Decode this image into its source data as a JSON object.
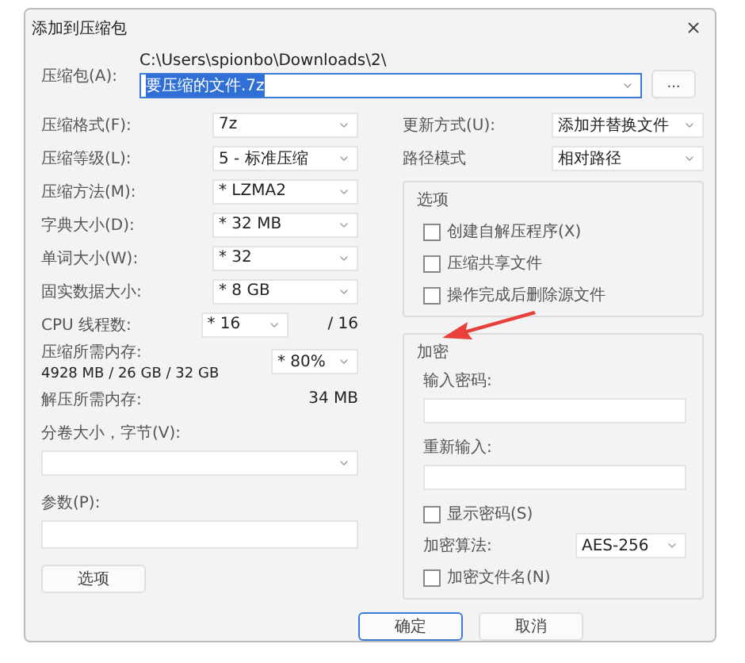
{
  "window": {
    "title": "添加到压缩包"
  },
  "archive": {
    "label": "压缩包(A):",
    "path": "C:\\Users\\spionbo\\Downloads\\2\\",
    "value": "要压缩的文件.7z",
    "value_selected": true,
    "browse": "..."
  },
  "left_fields": [
    {
      "kind": "combo",
      "label": "压缩格式(F):",
      "value": "7z"
    },
    {
      "kind": "combo",
      "label": "压缩等级(L):",
      "value": "5 - 标准压缩"
    },
    {
      "kind": "combo",
      "label": "压缩方法(M):",
      "value": "* LZMA2"
    },
    {
      "kind": "combo",
      "label": "字典大小(D):",
      "value": "* 32 MB"
    },
    {
      "kind": "combo",
      "label": "单词大小(W):",
      "value": "* 32"
    },
    {
      "kind": "combo",
      "label": "固实数据大小:",
      "value": "* 8 GB"
    },
    {
      "kind": "threads",
      "label": "CPU 线程数:",
      "value": "* 16",
      "suffix": "/ 16"
    },
    {
      "kind": "memory",
      "label": "压缩所需内存:",
      "detail": "4928 MB / 26 GB / 32 GB",
      "value": "* 80%"
    },
    {
      "kind": "info",
      "label": "解压所需内存:",
      "value": "34 MB"
    }
  ],
  "volume": {
    "label": "分卷大小，字节(V):"
  },
  "params": {
    "label": "参数(P):"
  },
  "options_button": "选项",
  "right_fields": [
    {
      "label": "更新方式(U):",
      "value": "添加并替换文件"
    },
    {
      "label": "路径模式",
      "value": "相对路径"
    }
  ],
  "options_group": {
    "title": "选项",
    "items": [
      {
        "label": "创建自解压程序(X)",
        "checked": false
      },
      {
        "label": "压缩共享文件",
        "checked": false
      },
      {
        "label": "操作完成后删除源文件",
        "checked": false
      }
    ]
  },
  "encryption": {
    "title": "加密",
    "password_label": "输入密码:",
    "reenter_label": "重新输入:",
    "show_password": {
      "label": "显示密码(S)",
      "checked": false
    },
    "method_label": "加密算法:",
    "method": "AES-256",
    "encrypt_names": {
      "label": "加密文件名(N)",
      "checked": false
    }
  },
  "buttons": [
    {
      "label": "确定",
      "default": true
    },
    {
      "label": "取消",
      "default": false
    }
  ]
}
